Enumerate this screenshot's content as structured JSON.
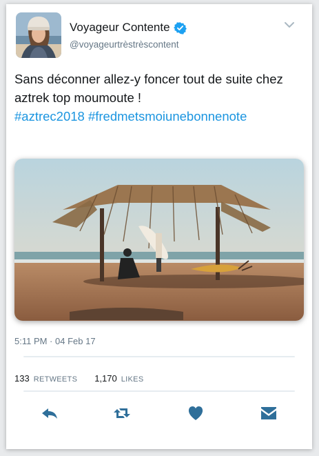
{
  "user": {
    "name": "Voyageur Contente",
    "handle": "@voyageurtrèstrèscontent",
    "verified": true
  },
  "tweet": {
    "text": "Sans déconner allez-y foncer tout de suite chez aztrek top moumoute !",
    "hashtags": [
      "#aztrec2018",
      "#fredmetsmoiunebonnenote"
    ]
  },
  "meta": {
    "timestamp": "5:11 PM · 04 Feb 17"
  },
  "stats": {
    "retweets_count": "133",
    "retweets_label": "RETWEETS",
    "likes_count": "1,170",
    "likes_label": "LIKES"
  },
  "actions": {
    "icons": [
      "reply-icon",
      "retweet-icon",
      "like-icon",
      "message-icon"
    ]
  },
  "colors": {
    "accent": "#1b95e0",
    "icon": "#2f6f9a",
    "verified": "#1da1f2"
  }
}
